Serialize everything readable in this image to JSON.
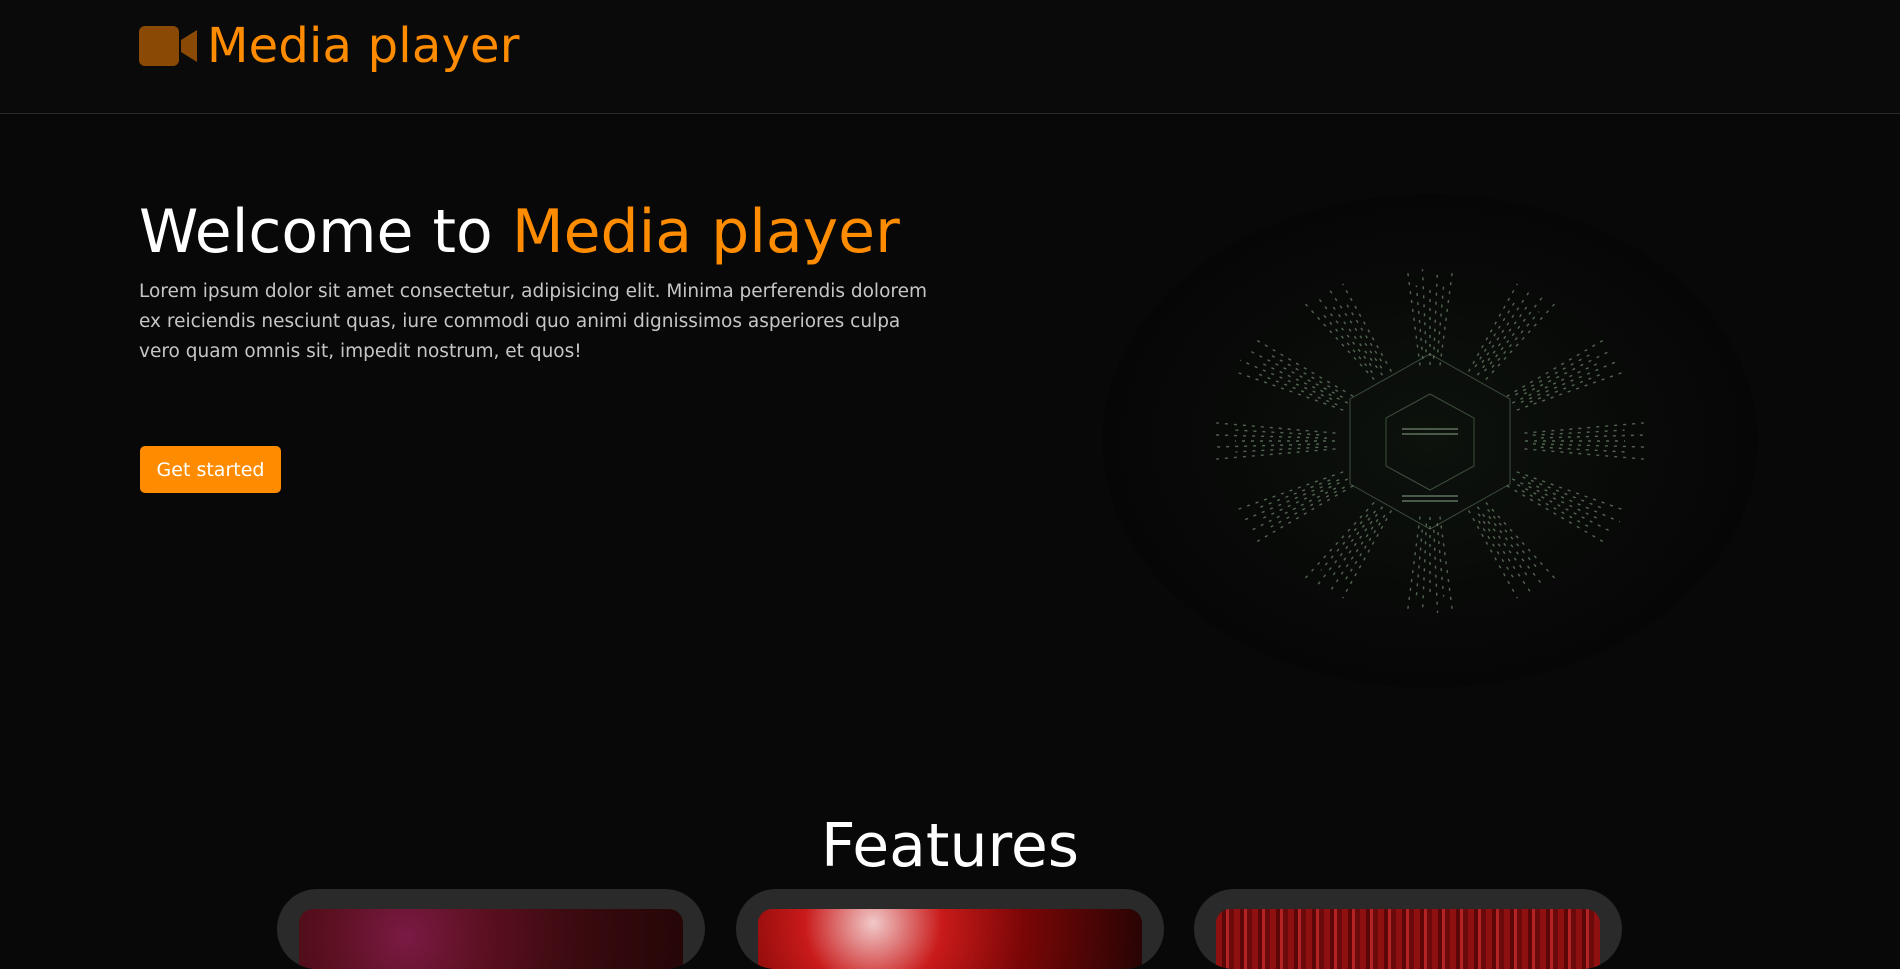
{
  "navbar": {
    "brand_icon": "video-camera-icon",
    "brand_name": "Media player",
    "accent_color": "#ff8c00"
  },
  "hero": {
    "title_prefix": "Welcome to ",
    "title_accent": "Media player",
    "description": "Lorem ipsum dolor sit amet consectetur, adipisicing elit. Minima perferendis dolorem ex reiciendis nesciunt quas, iure commodi quo animi dignissimos asperiores culpa vero quam omnis sit, impedit nostrum, et quos!",
    "cta_label": "Get started",
    "visual": "hexagonal-tunnel-image"
  },
  "features": {
    "title": "Features",
    "cards": [
      {
        "thumbnail": "purple-red-abstract-image"
      },
      {
        "thumbnail": "red-light-streak-image"
      },
      {
        "thumbnail": "red-particle-image"
      }
    ]
  }
}
